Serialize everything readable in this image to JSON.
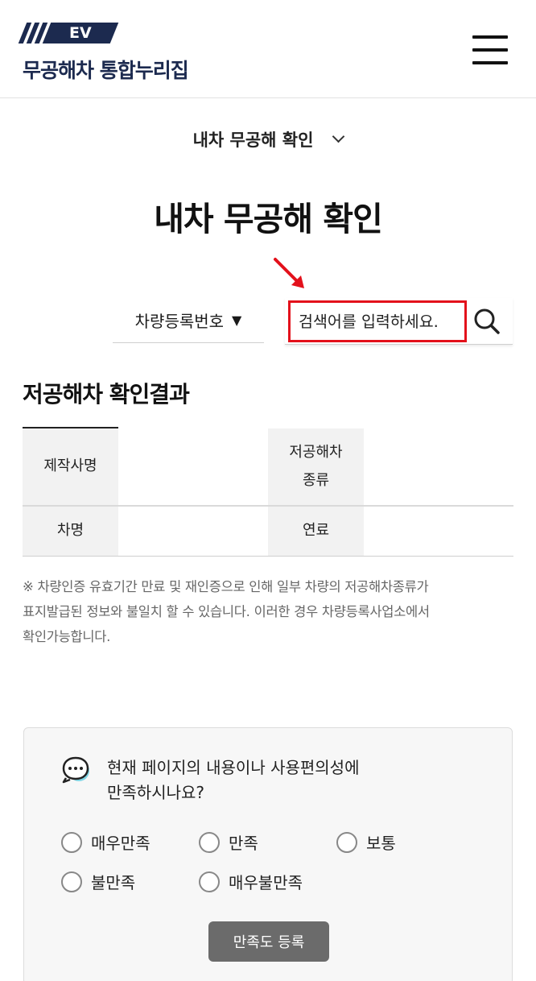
{
  "header": {
    "logo_badge": "EV",
    "logo_text": "무공해차 통합누리집",
    "menu_icon": "hamburger-menu-icon"
  },
  "section_selector": {
    "label": "내차 무공해 확인",
    "icon": "chevron-down-icon"
  },
  "page_title": "내차 무공해 확인",
  "search": {
    "type_label": "차량등록번호",
    "type_icon": "triangle-down-icon",
    "placeholder": "검색어를 입력하세요.",
    "button_icon": "search-icon",
    "highlight_color": "#e3111b"
  },
  "result": {
    "title": "저공해차 확인결과",
    "rows": [
      {
        "h1": "제작사명",
        "v1": "",
        "h2": "저공해차 종류",
        "v2": ""
      },
      {
        "h1": "차명",
        "v1": "",
        "h2": "연료",
        "v2": ""
      }
    ],
    "notice_lines": [
      "※ 차량인증 유효기간 만료 및 재인증으로 인해 일부 차량의 저공해차종류가",
      "표지발급된 정보와 불일치 할 수 있습니다. 이러한 경우 차량등록사업소에서",
      "확인가능합니다."
    ]
  },
  "survey": {
    "icon": "chat-bubble-icon",
    "question_lines": [
      "현재 페이지의 내용이나 사용편의성에",
      "만족하시나요?"
    ],
    "options": [
      "매우만족",
      "만족",
      "보통",
      "불만족",
      "매우불만족"
    ],
    "submit_label": "만족도 등록"
  }
}
